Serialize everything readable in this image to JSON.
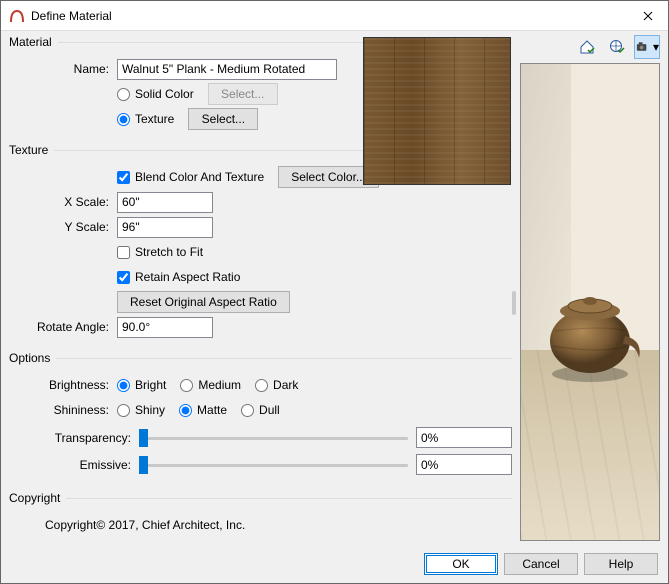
{
  "window": {
    "title": "Define Material"
  },
  "material": {
    "legend": "Material",
    "name_label": "Name:",
    "name_value": "Walnut 5\" Plank - Medium Rotated",
    "solid_label": "Solid Color",
    "texture_label": "Texture",
    "select_label": "Select..."
  },
  "texture": {
    "legend": "Texture",
    "blend_label": "Blend Color And Texture",
    "select_color_label": "Select Color...",
    "xscale_label": "X Scale:",
    "xscale_value": "60\"",
    "yscale_label": "Y Scale:",
    "yscale_value": "96\"",
    "stretch_label": "Stretch to Fit",
    "retain_label": "Retain Aspect Ratio",
    "reset_label": "Reset Original Aspect Ratio",
    "rotate_label": "Rotate Angle:",
    "rotate_value": "90.0°"
  },
  "options": {
    "legend": "Options",
    "brightness_label": "Brightness:",
    "brightness": {
      "bright": "Bright",
      "medium": "Medium",
      "dark": "Dark"
    },
    "shininess_label": "Shininess:",
    "shininess": {
      "shiny": "Shiny",
      "matte": "Matte",
      "dull": "Dull"
    },
    "transparency_label": "Transparency:",
    "transparency_value": "0%",
    "emissive_label": "Emissive:",
    "emissive_value": "0%"
  },
  "copyright": {
    "legend": "Copyright",
    "text": "Copyright© 2017, Chief Architect, Inc."
  },
  "footer": {
    "ok": "OK",
    "cancel": "Cancel",
    "help": "Help"
  },
  "toolbar": {
    "house_icon": "house-check-icon",
    "globe_icon": "globe-check-icon",
    "camera_icon": "camera-dropdown-icon"
  }
}
